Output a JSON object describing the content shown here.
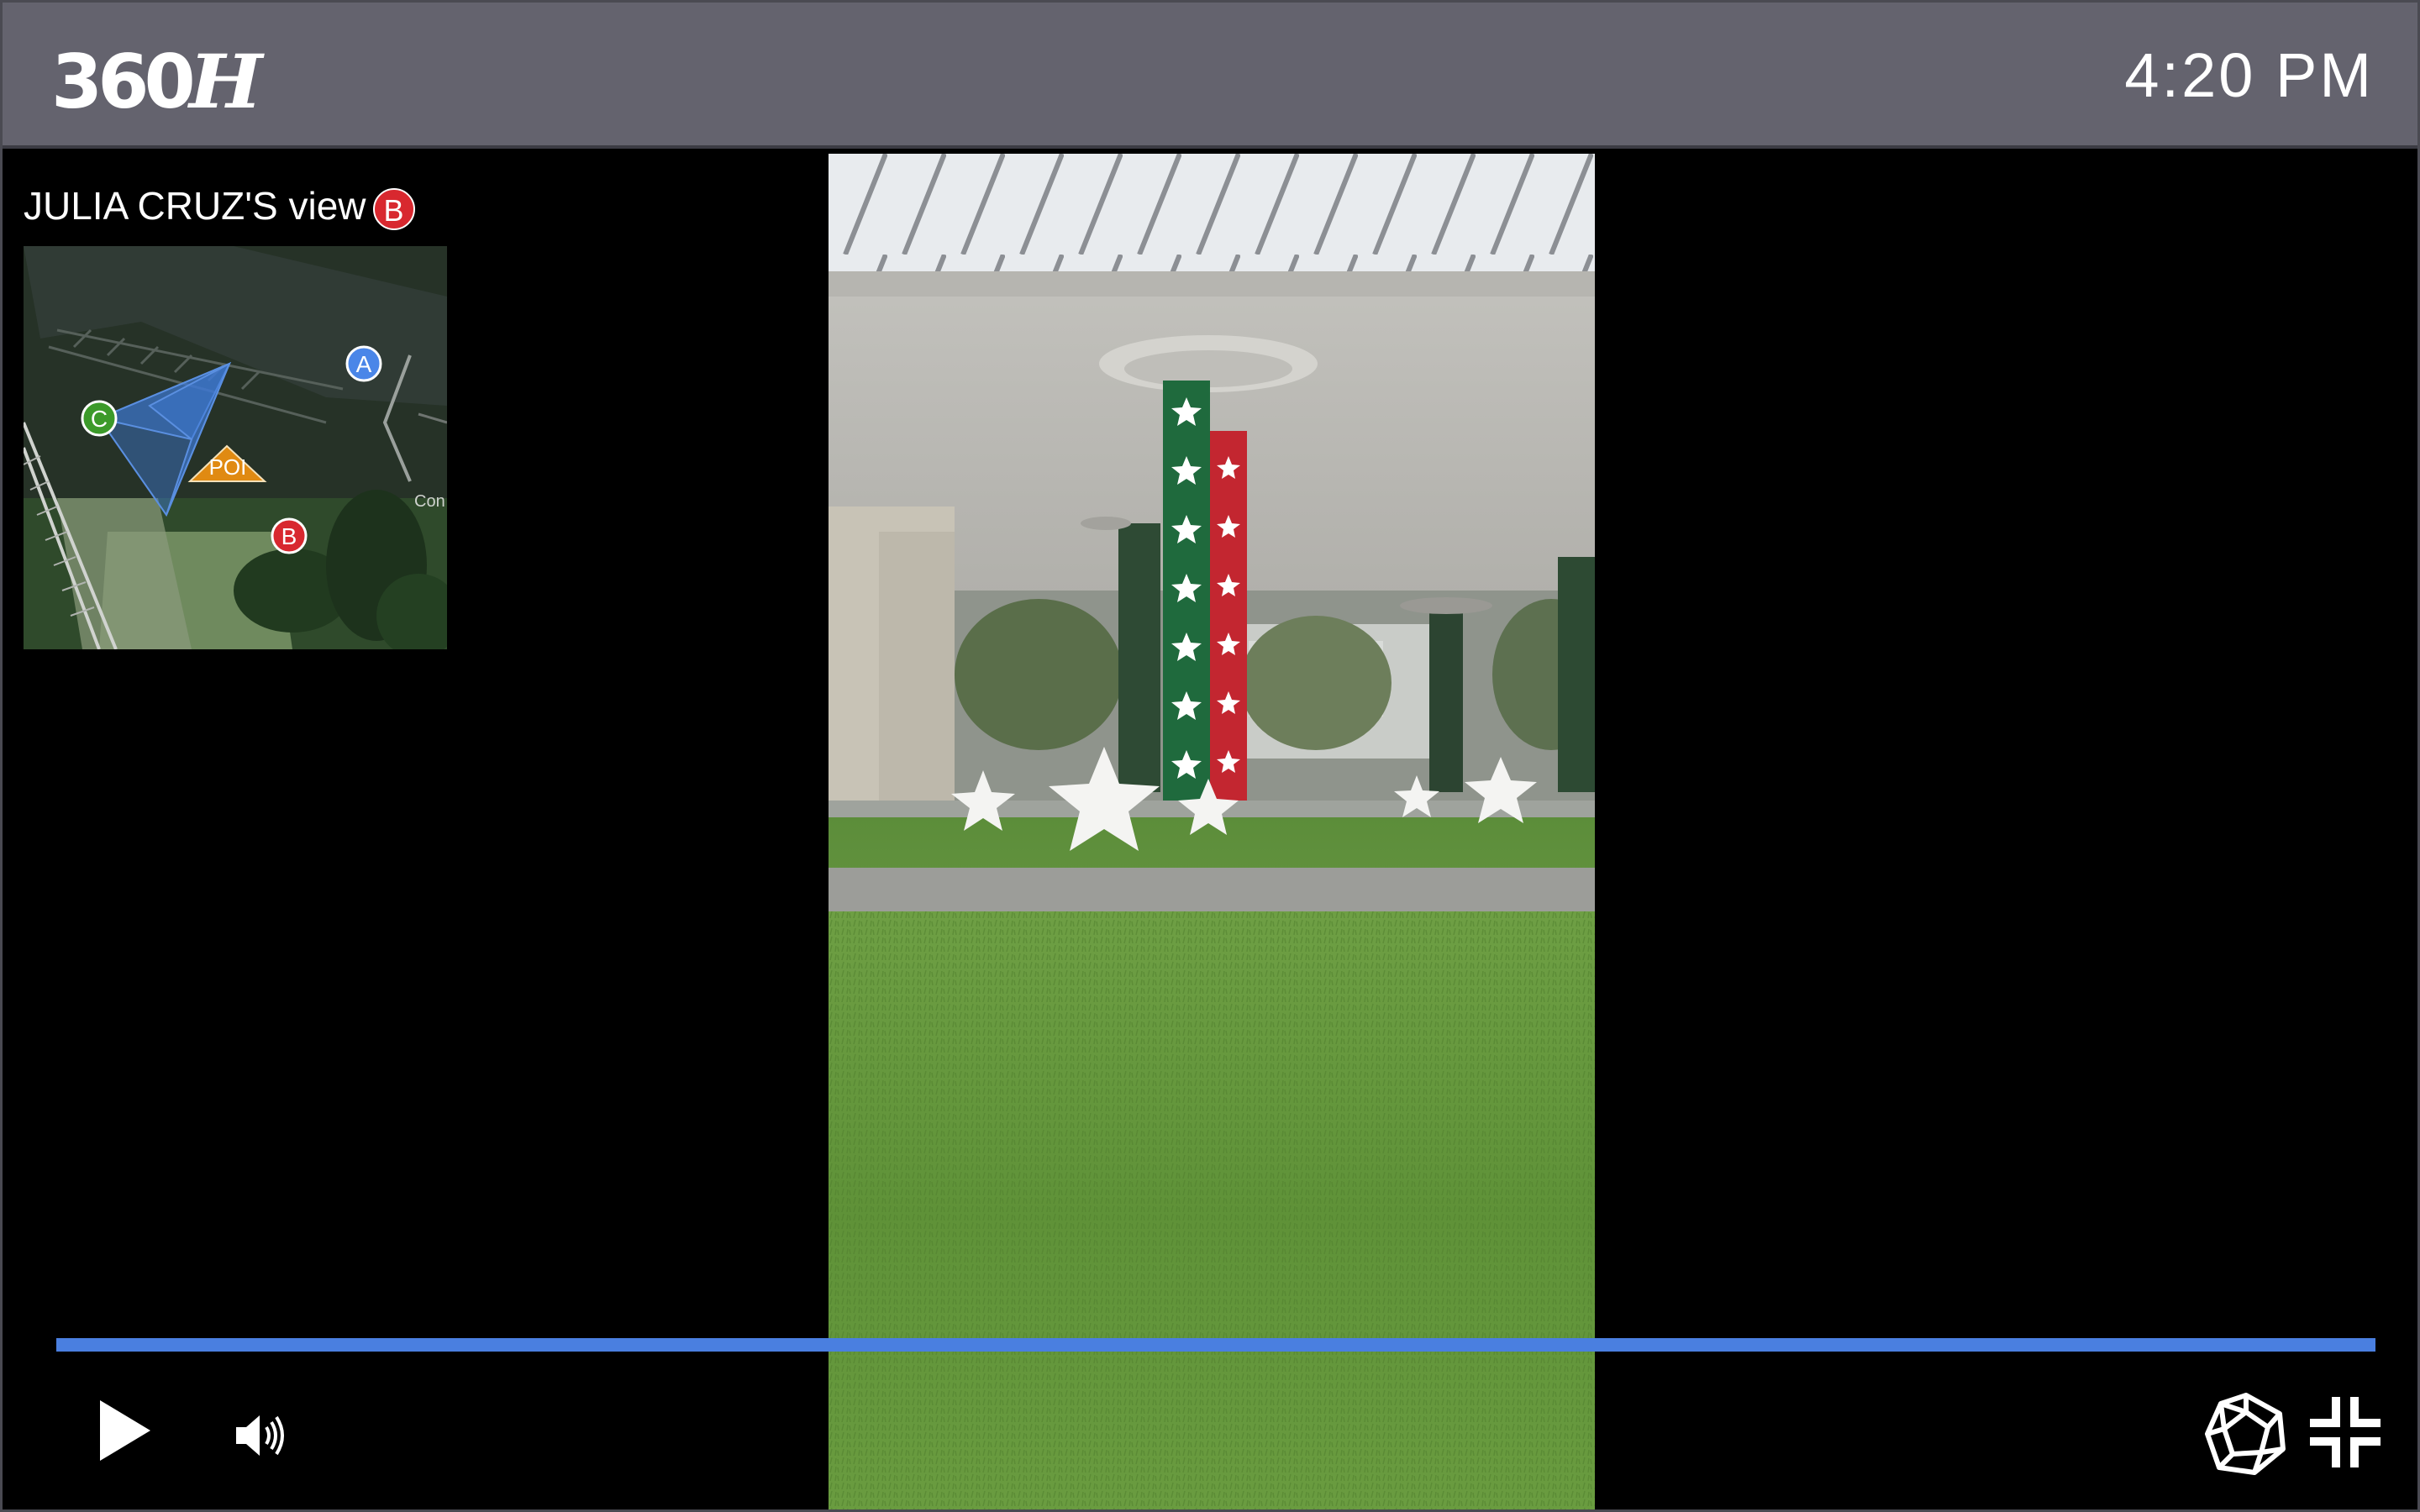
{
  "header": {
    "logo_text": "360",
    "logo_mark": "H",
    "time": "4:20 PM"
  },
  "viewer": {
    "name_label": "JULIA CRUZ'S view",
    "camera_id": "B",
    "camera_color": "#d8282f"
  },
  "minimap": {
    "poi_label": "POI",
    "map_text": "Con",
    "cameras": [
      {
        "id": "A",
        "color": "#4a86e8"
      },
      {
        "id": "B",
        "color": "#d8282f"
      },
      {
        "id": "C",
        "color": "#3c9a2a"
      }
    ],
    "poi_color": "#e08a12",
    "coverage_color": "#3d7ad6"
  },
  "controls": {
    "progress_fraction": 1.0,
    "progress_color": "#4a7fe0",
    "play_icon": "play-icon",
    "volume_icon": "volume-icon",
    "vr_icon": "vr-sphere-icon",
    "fullscreen_icon": "exit-fullscreen-icon"
  }
}
